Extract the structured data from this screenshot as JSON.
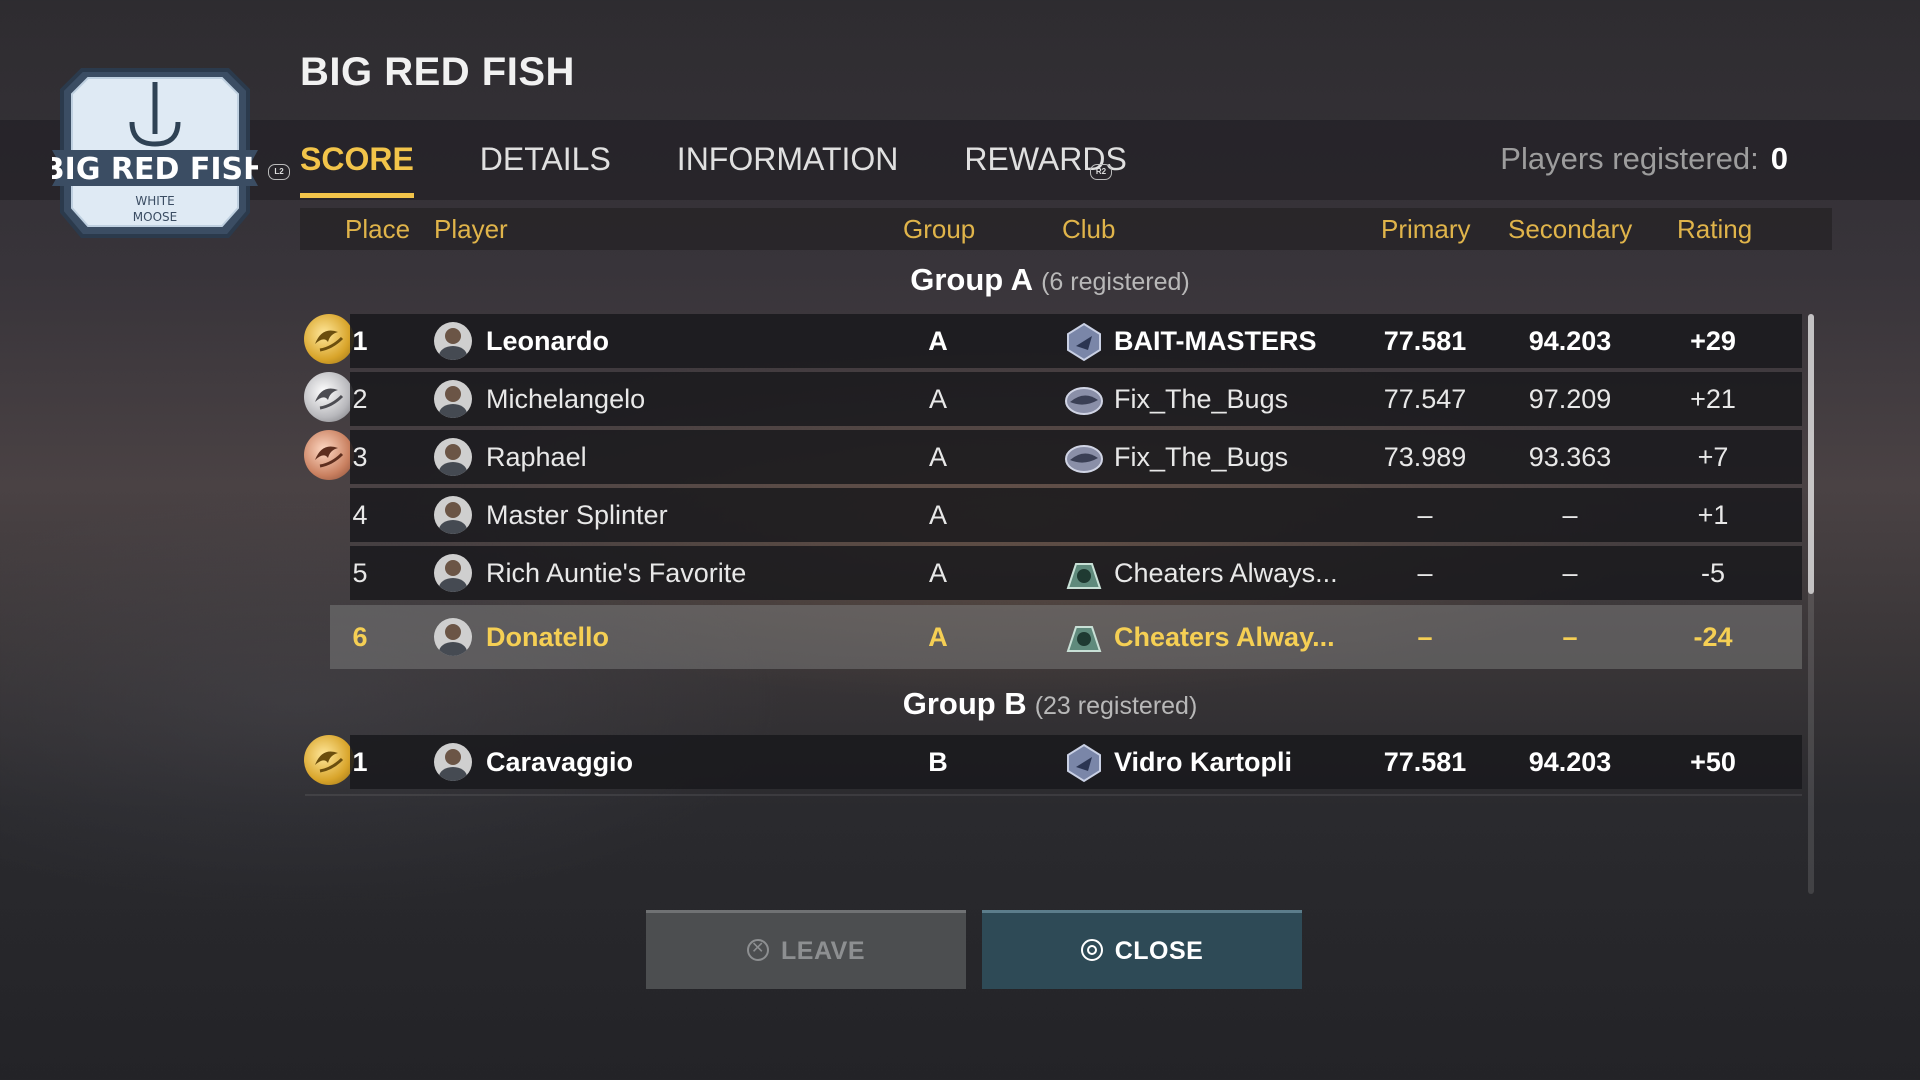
{
  "header": {
    "title": "BIG RED FISH",
    "logo": {
      "main_text": "BIG RED FISH",
      "sub_text": "WHITE MOOSE",
      "icon": "fishhook-icon"
    },
    "left_bumper_hint": "L2",
    "right_bumper_hint": "R2"
  },
  "tabs": [
    {
      "label": "SCORE",
      "active": true
    },
    {
      "label": "DETAILS",
      "active": false
    },
    {
      "label": "INFORMATION",
      "active": false
    },
    {
      "label": "REWARDS",
      "active": false
    }
  ],
  "players_registered": {
    "label": "Players registered:",
    "value": "0"
  },
  "columns": {
    "place": "Place",
    "player": "Player",
    "group": "Group",
    "club": "Club",
    "primary": "Primary",
    "secondary": "Secondary",
    "rating": "Rating"
  },
  "groups": [
    {
      "title": "Group A",
      "count": "(6 registered)",
      "rows": [
        {
          "place": "1",
          "player": "Leonardo",
          "group": "A",
          "club": "BAIT-MASTERS",
          "primary": "77.581",
          "secondary": "94.203",
          "rating": "+29",
          "medal": "gold"
        },
        {
          "place": "2",
          "player": "Michelangelo",
          "group": "A",
          "club": "Fix_The_Bugs",
          "primary": "77.547",
          "secondary": "97.209",
          "rating": "+21",
          "medal": "silver"
        },
        {
          "place": "3",
          "player": "Raphael",
          "group": "A",
          "club": "Fix_The_Bugs",
          "primary": "73.989",
          "secondary": "93.363",
          "rating": "+7",
          "medal": "bronze"
        },
        {
          "place": "4",
          "player": "Master Splinter",
          "group": "A",
          "club": "",
          "primary": "–",
          "secondary": "–",
          "rating": "+1"
        },
        {
          "place": "5",
          "player": "Rich Auntie's Favorite",
          "group": "A",
          "club": "Cheaters Always...",
          "primary": "–",
          "secondary": "–",
          "rating": "-5"
        },
        {
          "place": "6",
          "player": "Donatello",
          "group": "A",
          "club": "Cheaters Alway...",
          "primary": "–",
          "secondary": "–",
          "rating": "-24",
          "selected": true
        }
      ]
    },
    {
      "title": "Group B",
      "count": "(23 registered)",
      "rows": [
        {
          "place": "1",
          "player": "Caravaggio",
          "group": "B",
          "club": "Vidro Kartopli",
          "primary": "77.581",
          "secondary": "94.203",
          "rating": "+50",
          "medal": "gold"
        }
      ]
    }
  ],
  "buttons": {
    "leave": "LEAVE",
    "close": "CLOSE"
  },
  "colors": {
    "accent": "#f2c44a",
    "close_button": "#2e4a56",
    "leave_button": "#5a5c5e"
  }
}
